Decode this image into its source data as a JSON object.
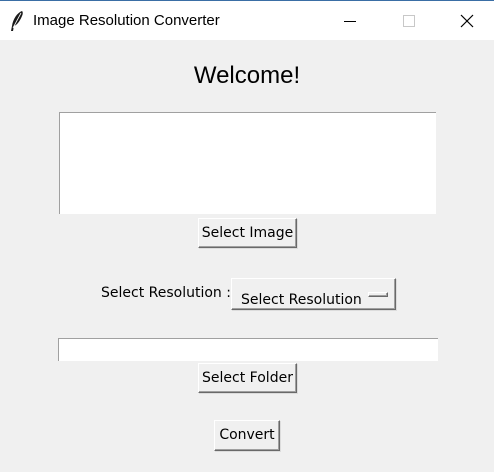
{
  "window": {
    "title": "Image Resolution Converter",
    "icon": "feather-icon",
    "controls": {
      "minimize": "minimize-icon",
      "maximize": "maximize-icon",
      "close": "close-icon"
    }
  },
  "main": {
    "heading": "Welcome!",
    "select_image_label": "Select Image",
    "resolution_label": "Select Resolution :",
    "resolution_selected": "Select Resolution",
    "folder_path": "",
    "select_folder_label": "Select Folder",
    "convert_label": "Convert"
  }
}
